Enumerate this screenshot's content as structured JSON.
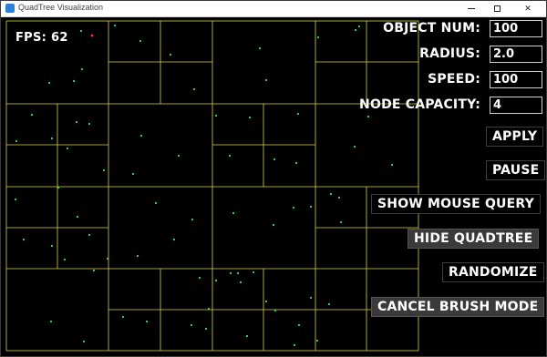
{
  "window": {
    "title": "QuadTree Visualization"
  },
  "stats": {
    "fps": "FPS: 62"
  },
  "settings": {
    "object_num": {
      "label": "OBJECT NUM:",
      "value": "100"
    },
    "radius": {
      "label": "RADIUS:",
      "value": "2.0"
    },
    "speed": {
      "label": "SPEED:",
      "value": "100"
    },
    "node_capacity": {
      "label": "NODE CAPACITY:",
      "value": "4"
    }
  },
  "buttons": {
    "apply": "APPLY",
    "pause": "PAUSE",
    "show_mouse_query": "SHOW MOUSE QUERY",
    "hide_quadtree": "HIDE QUADTREE",
    "randomize": "RANDOMIZE",
    "cancel_brush": "CANCEL BRUSH MODE"
  },
  "colors": {
    "quadtree_lines": "#d9d24a",
    "particles": "#37e05b",
    "highlight_particle": "#e53b3b"
  }
}
